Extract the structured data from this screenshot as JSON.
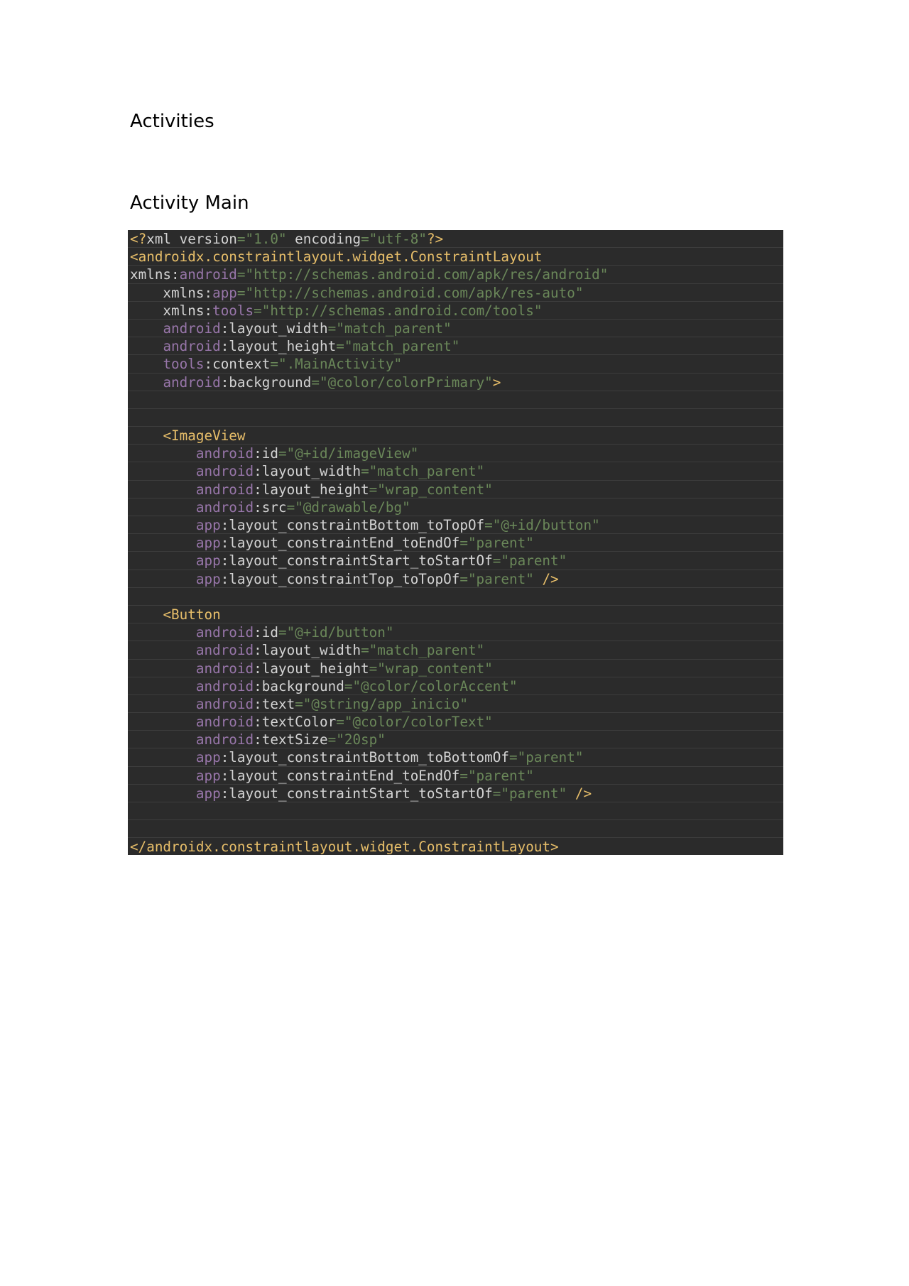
{
  "headings": {
    "title": "Activities",
    "subtitle": "Activity Main"
  },
  "code": {
    "language": "xml",
    "colors": {
      "background": "#2b2b2b",
      "tag": "#e8bf6a",
      "text": "#d4d4d4",
      "namespace": "#9876aa",
      "string": "#6a8759"
    },
    "lines": [
      [
        {
          "t": "tag",
          "v": "<?"
        },
        {
          "t": "text",
          "v": "xml version"
        },
        {
          "t": "eq",
          "v": "="
        },
        {
          "t": "str",
          "v": "\"1.0\""
        },
        {
          "t": "text",
          "v": " encoding"
        },
        {
          "t": "eq",
          "v": "="
        },
        {
          "t": "str",
          "v": "\"utf-8\""
        },
        {
          "t": "tag",
          "v": "?>"
        }
      ],
      [
        {
          "t": "tag",
          "v": "<androidx.constraintlayout.widget.ConstraintLayout"
        }
      ],
      [
        {
          "t": "text",
          "v": "xmlns:"
        },
        {
          "t": "ns",
          "v": "android"
        },
        {
          "t": "eq",
          "v": "="
        },
        {
          "t": "str",
          "v": "\"http://schemas.android.com/apk/res/android\""
        }
      ],
      [
        {
          "t": "text",
          "v": "    xmlns:"
        },
        {
          "t": "ns",
          "v": "app"
        },
        {
          "t": "eq",
          "v": "="
        },
        {
          "t": "str",
          "v": "\"http://schemas.android.com/apk/res-auto\""
        }
      ],
      [
        {
          "t": "text",
          "v": "    xmlns:"
        },
        {
          "t": "ns",
          "v": "tools"
        },
        {
          "t": "eq",
          "v": "="
        },
        {
          "t": "str",
          "v": "\"http://schemas.android.com/tools\""
        }
      ],
      [
        {
          "t": "text",
          "v": "    "
        },
        {
          "t": "ns",
          "v": "android"
        },
        {
          "t": "text",
          "v": ":layout_width"
        },
        {
          "t": "eq",
          "v": "="
        },
        {
          "t": "str",
          "v": "\"match_parent\""
        }
      ],
      [
        {
          "t": "text",
          "v": "    "
        },
        {
          "t": "ns",
          "v": "android"
        },
        {
          "t": "text",
          "v": ":layout_height"
        },
        {
          "t": "eq",
          "v": "="
        },
        {
          "t": "str",
          "v": "\"match_parent\""
        }
      ],
      [
        {
          "t": "text",
          "v": "    "
        },
        {
          "t": "ns",
          "v": "tools"
        },
        {
          "t": "text",
          "v": ":context"
        },
        {
          "t": "eq",
          "v": "="
        },
        {
          "t": "str",
          "v": "\".MainActivity\""
        }
      ],
      [
        {
          "t": "text",
          "v": "    "
        },
        {
          "t": "ns",
          "v": "android"
        },
        {
          "t": "text",
          "v": ":background"
        },
        {
          "t": "eq",
          "v": "="
        },
        {
          "t": "str",
          "v": "\"@color/colorPrimary\""
        },
        {
          "t": "tag",
          "v": ">"
        }
      ],
      [
        {
          "t": "text",
          "v": ""
        }
      ],
      [
        {
          "t": "text",
          "v": ""
        }
      ],
      [
        {
          "t": "text",
          "v": "    "
        },
        {
          "t": "tag",
          "v": "<ImageView"
        }
      ],
      [
        {
          "t": "text",
          "v": "        "
        },
        {
          "t": "ns",
          "v": "android"
        },
        {
          "t": "text",
          "v": ":id"
        },
        {
          "t": "eq",
          "v": "="
        },
        {
          "t": "str",
          "v": "\"@+id/imageView\""
        }
      ],
      [
        {
          "t": "text",
          "v": "        "
        },
        {
          "t": "ns",
          "v": "android"
        },
        {
          "t": "text",
          "v": ":layout_width"
        },
        {
          "t": "eq",
          "v": "="
        },
        {
          "t": "str",
          "v": "\"match_parent\""
        }
      ],
      [
        {
          "t": "text",
          "v": "        "
        },
        {
          "t": "ns",
          "v": "android"
        },
        {
          "t": "text",
          "v": ":layout_height"
        },
        {
          "t": "eq",
          "v": "="
        },
        {
          "t": "str",
          "v": "\"wrap_content\""
        }
      ],
      [
        {
          "t": "text",
          "v": "        "
        },
        {
          "t": "ns",
          "v": "android"
        },
        {
          "t": "text",
          "v": ":src"
        },
        {
          "t": "eq",
          "v": "="
        },
        {
          "t": "str",
          "v": "\"@drawable/bg\""
        }
      ],
      [
        {
          "t": "text",
          "v": "        "
        },
        {
          "t": "ns",
          "v": "app"
        },
        {
          "t": "text",
          "v": ":layout_constraintBottom_toTopOf"
        },
        {
          "t": "eq",
          "v": "="
        },
        {
          "t": "str",
          "v": "\"@+id/button\""
        }
      ],
      [
        {
          "t": "text",
          "v": "        "
        },
        {
          "t": "ns",
          "v": "app"
        },
        {
          "t": "text",
          "v": ":layout_constraintEnd_toEndOf"
        },
        {
          "t": "eq",
          "v": "="
        },
        {
          "t": "str",
          "v": "\"parent\""
        }
      ],
      [
        {
          "t": "text",
          "v": "        "
        },
        {
          "t": "ns",
          "v": "app"
        },
        {
          "t": "text",
          "v": ":layout_constraintStart_toStartOf"
        },
        {
          "t": "eq",
          "v": "="
        },
        {
          "t": "str",
          "v": "\"parent\""
        }
      ],
      [
        {
          "t": "text",
          "v": "        "
        },
        {
          "t": "ns",
          "v": "app"
        },
        {
          "t": "text",
          "v": ":layout_constraintTop_toTopOf"
        },
        {
          "t": "eq",
          "v": "="
        },
        {
          "t": "str",
          "v": "\"parent\""
        },
        {
          "t": "text",
          "v": " "
        },
        {
          "t": "tag",
          "v": "/>"
        }
      ],
      [
        {
          "t": "text",
          "v": ""
        }
      ],
      [
        {
          "t": "text",
          "v": "    "
        },
        {
          "t": "tag",
          "v": "<Button"
        }
      ],
      [
        {
          "t": "text",
          "v": "        "
        },
        {
          "t": "ns",
          "v": "android"
        },
        {
          "t": "text",
          "v": ":id"
        },
        {
          "t": "eq",
          "v": "="
        },
        {
          "t": "str",
          "v": "\"@+id/button\""
        }
      ],
      [
        {
          "t": "text",
          "v": "        "
        },
        {
          "t": "ns",
          "v": "android"
        },
        {
          "t": "text",
          "v": ":layout_width"
        },
        {
          "t": "eq",
          "v": "="
        },
        {
          "t": "str",
          "v": "\"match_parent\""
        }
      ],
      [
        {
          "t": "text",
          "v": "        "
        },
        {
          "t": "ns",
          "v": "android"
        },
        {
          "t": "text",
          "v": ":layout_height"
        },
        {
          "t": "eq",
          "v": "="
        },
        {
          "t": "str",
          "v": "\"wrap_content\""
        }
      ],
      [
        {
          "t": "text",
          "v": "        "
        },
        {
          "t": "ns",
          "v": "android"
        },
        {
          "t": "text",
          "v": ":background"
        },
        {
          "t": "eq",
          "v": "="
        },
        {
          "t": "str",
          "v": "\"@color/colorAccent\""
        }
      ],
      [
        {
          "t": "text",
          "v": "        "
        },
        {
          "t": "ns",
          "v": "android"
        },
        {
          "t": "text",
          "v": ":text"
        },
        {
          "t": "eq",
          "v": "="
        },
        {
          "t": "str",
          "v": "\"@string/app_inicio\""
        }
      ],
      [
        {
          "t": "text",
          "v": "        "
        },
        {
          "t": "ns",
          "v": "android"
        },
        {
          "t": "text",
          "v": ":textColor"
        },
        {
          "t": "eq",
          "v": "="
        },
        {
          "t": "str",
          "v": "\"@color/colorText\""
        }
      ],
      [
        {
          "t": "text",
          "v": "        "
        },
        {
          "t": "ns",
          "v": "android"
        },
        {
          "t": "text",
          "v": ":textSize"
        },
        {
          "t": "eq",
          "v": "="
        },
        {
          "t": "str",
          "v": "\"20sp\""
        }
      ],
      [
        {
          "t": "text",
          "v": "        "
        },
        {
          "t": "ns",
          "v": "app"
        },
        {
          "t": "text",
          "v": ":layout_constraintBottom_toBottomOf"
        },
        {
          "t": "eq",
          "v": "="
        },
        {
          "t": "str",
          "v": "\"parent\""
        }
      ],
      [
        {
          "t": "text",
          "v": "        "
        },
        {
          "t": "ns",
          "v": "app"
        },
        {
          "t": "text",
          "v": ":layout_constraintEnd_toEndOf"
        },
        {
          "t": "eq",
          "v": "="
        },
        {
          "t": "str",
          "v": "\"parent\""
        }
      ],
      [
        {
          "t": "text",
          "v": "        "
        },
        {
          "t": "ns",
          "v": "app"
        },
        {
          "t": "text",
          "v": ":layout_constraintStart_toStartOf"
        },
        {
          "t": "eq",
          "v": "="
        },
        {
          "t": "str",
          "v": "\"parent\""
        },
        {
          "t": "text",
          "v": " "
        },
        {
          "t": "tag",
          "v": "/>"
        }
      ],
      [
        {
          "t": "text",
          "v": ""
        }
      ],
      [
        {
          "t": "text",
          "v": ""
        }
      ],
      [
        {
          "t": "tag",
          "v": "</androidx.constraintlayout.widget.ConstraintLayout>"
        }
      ]
    ]
  }
}
